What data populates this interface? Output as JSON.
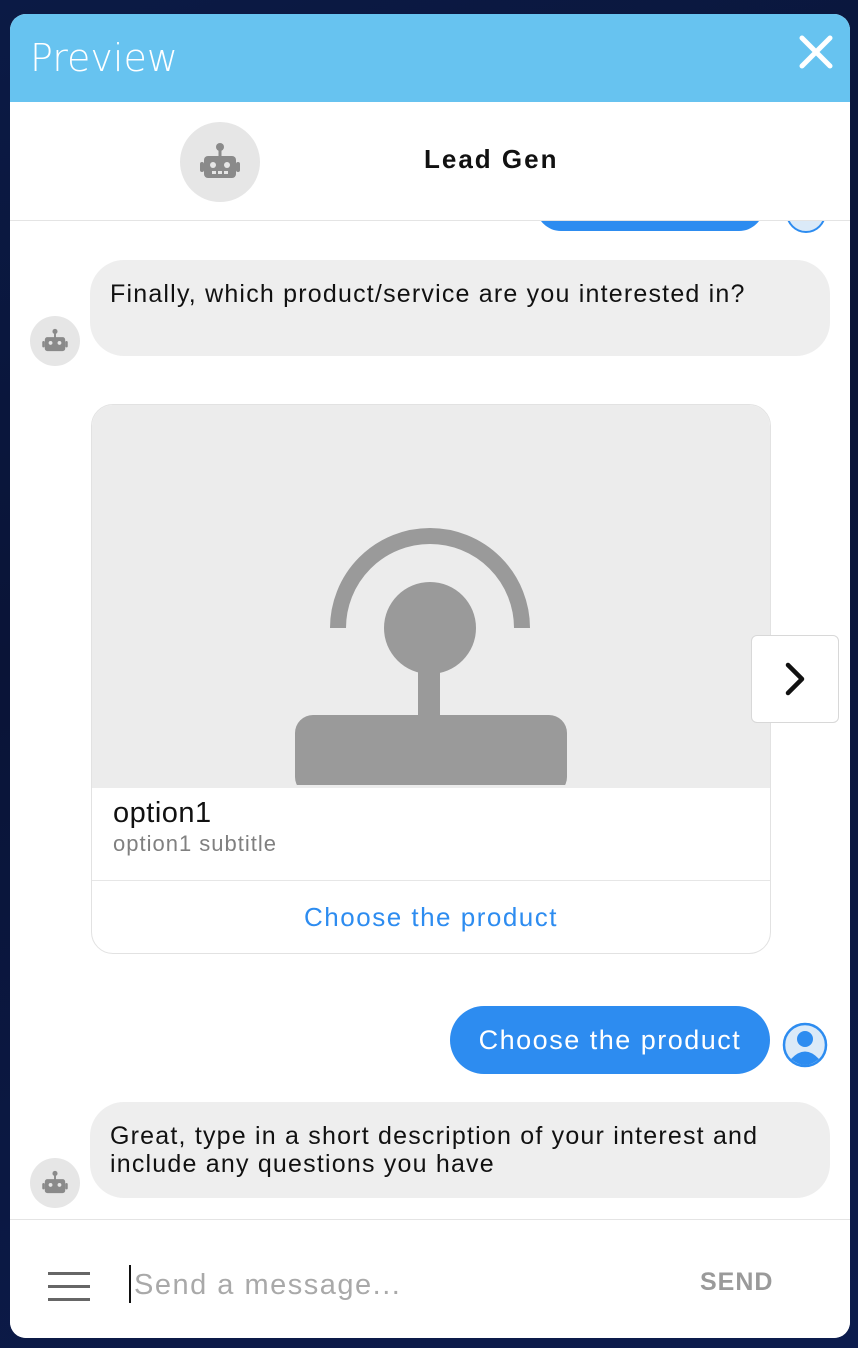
{
  "window": {
    "title": "Preview",
    "accent_color": "#67c3f0",
    "close_icon": "close-icon"
  },
  "header": {
    "bot_name": "Lead Gen",
    "avatar_icon": "robot-icon"
  },
  "messages": {
    "bot_question": "Finally, which product/service are you interested in?",
    "card": {
      "title": "option1",
      "subtitle": "option1 subtitle",
      "button_label": "Choose the product",
      "image_icon": "placeholder-image-icon",
      "next_icon": "chevron-right-icon"
    },
    "user_reply": "Choose the product",
    "bot_followup": "Great, type in a short description of your interest and include any questions you have"
  },
  "composer": {
    "placeholder": "Send a message...",
    "send_label": "SEND",
    "menu_icon": "hamburger-menu-icon"
  },
  "colors": {
    "user_bubble": "#2d8cf0",
    "bot_bubble": "#eeeeee"
  }
}
